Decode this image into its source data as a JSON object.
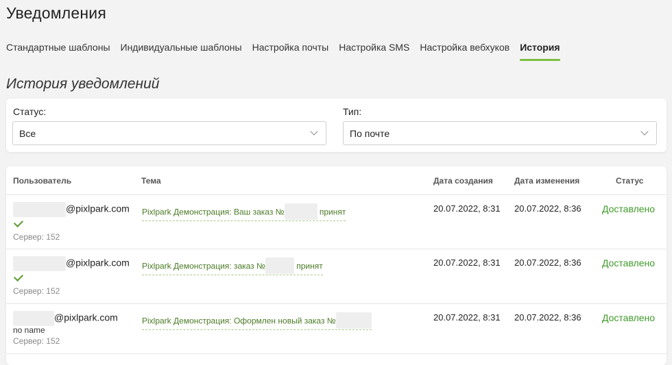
{
  "page": {
    "title": "Уведомления"
  },
  "tabs": [
    {
      "label": "Стандартные шаблоны"
    },
    {
      "label": "Индивидуальные шаблоны"
    },
    {
      "label": "Настройка почты"
    },
    {
      "label": "Настройка SMS"
    },
    {
      "label": "Настройка вебхуков"
    },
    {
      "label": "История"
    }
  ],
  "active_tab": "История",
  "section": {
    "title": "История уведомлений"
  },
  "filters": {
    "status": {
      "label": "Статус:",
      "value": "Все"
    },
    "type": {
      "label": "Тип:",
      "value": "По почте"
    }
  },
  "table": {
    "headers": [
      "Пользователь",
      "Тема",
      "Дата создания",
      "Дата изменения",
      "Статус"
    ],
    "rows": [
      {
        "email_domain": "@pixlpark.com",
        "server": "Сервер: 152",
        "subject_prefix": "Pixlpark Демонстрация: Ваш заказ №",
        "subject_suffix": "принят",
        "created": "20.07.2022, 8:31",
        "modified": "20.07.2022, 8:36",
        "status": "Доставлено"
      },
      {
        "email_domain": "@pixlpark.com",
        "server": "Сервер: 152",
        "subject_prefix": "Pixlpark Демонстрация: заказ №",
        "subject_suffix": "принят",
        "created": "20.07.2022, 8:31",
        "modified": "20.07.2022, 8:36",
        "status": "Доставлено"
      },
      {
        "email_domain": "@pixlpark.com",
        "name": "no name",
        "server": "Сервер: 152",
        "subject_prefix": "Pixlpark Демонстрация: Оформлен новый заказ №",
        "subject_suffix": "",
        "created": "20.07.2022, 8:31",
        "modified": "20.07.2022, 8:36",
        "status": "Доставлено"
      }
    ]
  },
  "colors": {
    "accent": "#7cbf3f",
    "status_ok": "#3f9a2a",
    "link": "#4a7a25"
  }
}
